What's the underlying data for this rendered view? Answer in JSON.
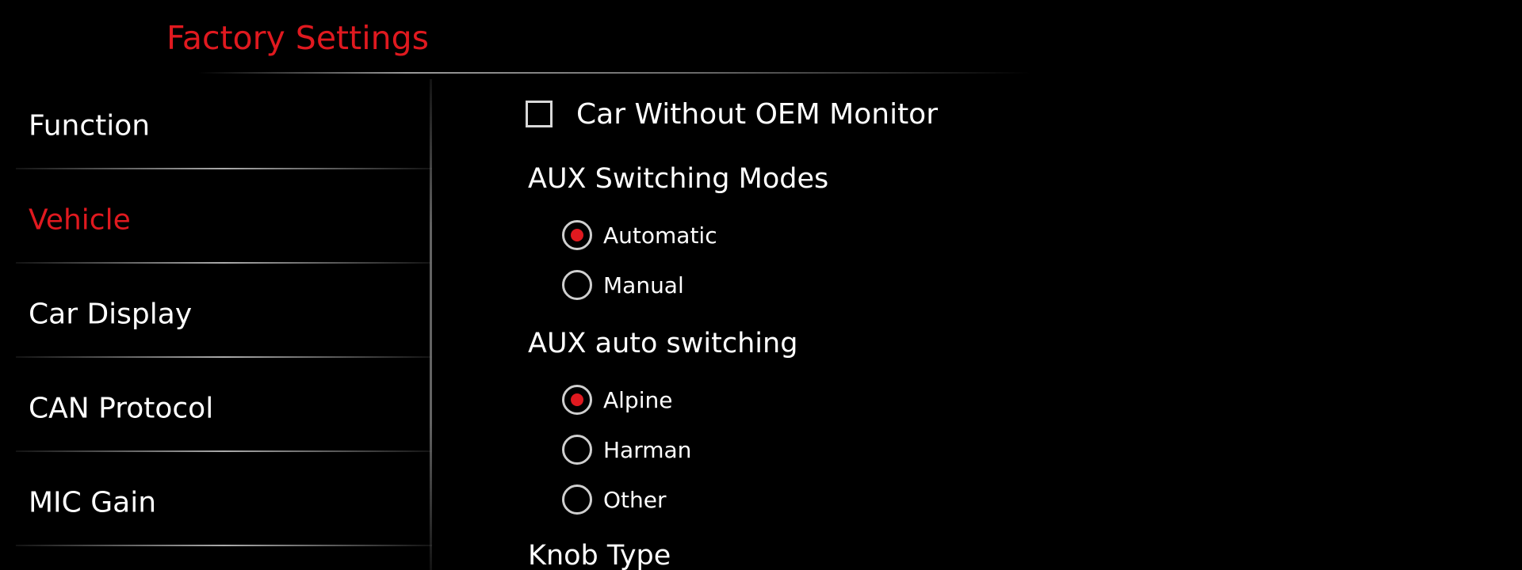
{
  "header": {
    "title": "Factory Settings"
  },
  "sidebar": {
    "items": [
      {
        "label": "Function",
        "active": false
      },
      {
        "label": "Vehicle",
        "active": true
      },
      {
        "label": "Car Display",
        "active": false
      },
      {
        "label": "CAN Protocol",
        "active": false
      },
      {
        "label": "MIC Gain",
        "active": false
      }
    ]
  },
  "main": {
    "car_without_oem_monitor": {
      "label": "Car Without OEM Monitor",
      "checked": false
    },
    "aux_switching_modes": {
      "heading": "AUX Switching Modes",
      "options": [
        {
          "label": "Automatic",
          "selected": true
        },
        {
          "label": "Manual",
          "selected": false
        }
      ]
    },
    "aux_auto_switching": {
      "heading": "AUX auto switching",
      "options": [
        {
          "label": "Alpine",
          "selected": true
        },
        {
          "label": "Harman",
          "selected": false
        },
        {
          "label": "Other",
          "selected": false
        }
      ]
    },
    "knob_type": {
      "heading": "Knob Type"
    }
  },
  "colors": {
    "accent": "#e0191f",
    "background": "#000000",
    "text": "#ffffff"
  }
}
